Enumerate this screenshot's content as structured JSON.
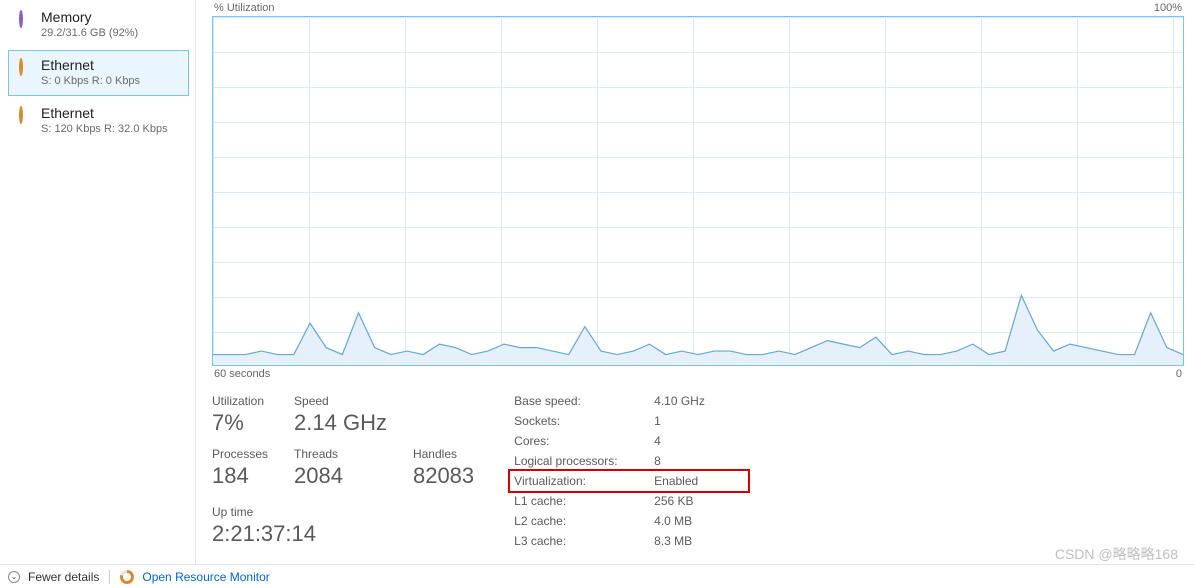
{
  "sidebar": {
    "items": [
      {
        "title": "Memory",
        "sub": "29.2/31.6 GB (92%)",
        "icon": "ring-purple",
        "selected": false
      },
      {
        "title": "Ethernet",
        "sub": "S: 0 Kbps  R: 0 Kbps",
        "icon": "ring-orange",
        "selected": true
      },
      {
        "title": "Ethernet",
        "sub": "S: 120 Kbps  R: 32.0 Kbps",
        "icon": "ring-orange",
        "selected": false
      }
    ]
  },
  "chart": {
    "y_label": "% Utilization",
    "y_max": "100%",
    "x_left": "60 seconds",
    "x_right": "0"
  },
  "chart_data": {
    "type": "area",
    "title": "% Utilization",
    "xlabel": "seconds",
    "ylabel": "% Utilization",
    "xlim": [
      60,
      0
    ],
    "ylim": [
      0,
      100
    ],
    "x": [
      60,
      59,
      58,
      57,
      56,
      55,
      54,
      53,
      52,
      51,
      50,
      49,
      48,
      47,
      46,
      45,
      44,
      43,
      42,
      41,
      40,
      39,
      38,
      37,
      36,
      35,
      34,
      33,
      32,
      31,
      30,
      29,
      28,
      27,
      26,
      25,
      24,
      23,
      22,
      21,
      20,
      19,
      18,
      17,
      16,
      15,
      14,
      13,
      12,
      11,
      10,
      9,
      8,
      7,
      6,
      5,
      4,
      3,
      2,
      1,
      0
    ],
    "values": [
      3,
      3,
      3,
      4,
      3,
      3,
      12,
      5,
      3,
      15,
      5,
      3,
      4,
      3,
      6,
      5,
      3,
      4,
      6,
      5,
      5,
      4,
      3,
      11,
      4,
      3,
      4,
      6,
      3,
      4,
      3,
      4,
      4,
      3,
      3,
      4,
      3,
      5,
      7,
      6,
      5,
      8,
      3,
      4,
      3,
      3,
      4,
      6,
      3,
      4,
      20,
      10,
      4,
      6,
      5,
      4,
      3,
      3,
      15,
      5,
      3
    ],
    "color_line": "#67a6d8",
    "color_fill": "#e5f0fa"
  },
  "stats_left": {
    "utilization_label": "Utilization",
    "utilization_value": "7%",
    "speed_label": "Speed",
    "speed_value": "2.14 GHz",
    "processes_label": "Processes",
    "processes_value": "184",
    "threads_label": "Threads",
    "threads_value": "2084",
    "handles_label": "Handles",
    "handles_value": "82083",
    "uptime_label": "Up time",
    "uptime_value": "2:21:37:14"
  },
  "stats_right": [
    {
      "k": "Base speed:",
      "v": "4.10 GHz"
    },
    {
      "k": "Sockets:",
      "v": "1"
    },
    {
      "k": "Cores:",
      "v": "4"
    },
    {
      "k": "Logical processors:",
      "v": "8"
    },
    {
      "k": "Virtualization:",
      "v": "Enabled",
      "highlight": true
    },
    {
      "k": "L1 cache:",
      "v": "256 KB"
    },
    {
      "k": "L2 cache:",
      "v": "4.0 MB"
    },
    {
      "k": "L3 cache:",
      "v": "8.3 MB"
    }
  ],
  "bottom": {
    "fewer_details": "Fewer details",
    "open_resmon": "Open Resource Monitor"
  },
  "watermark": "CSDN @略略略168"
}
